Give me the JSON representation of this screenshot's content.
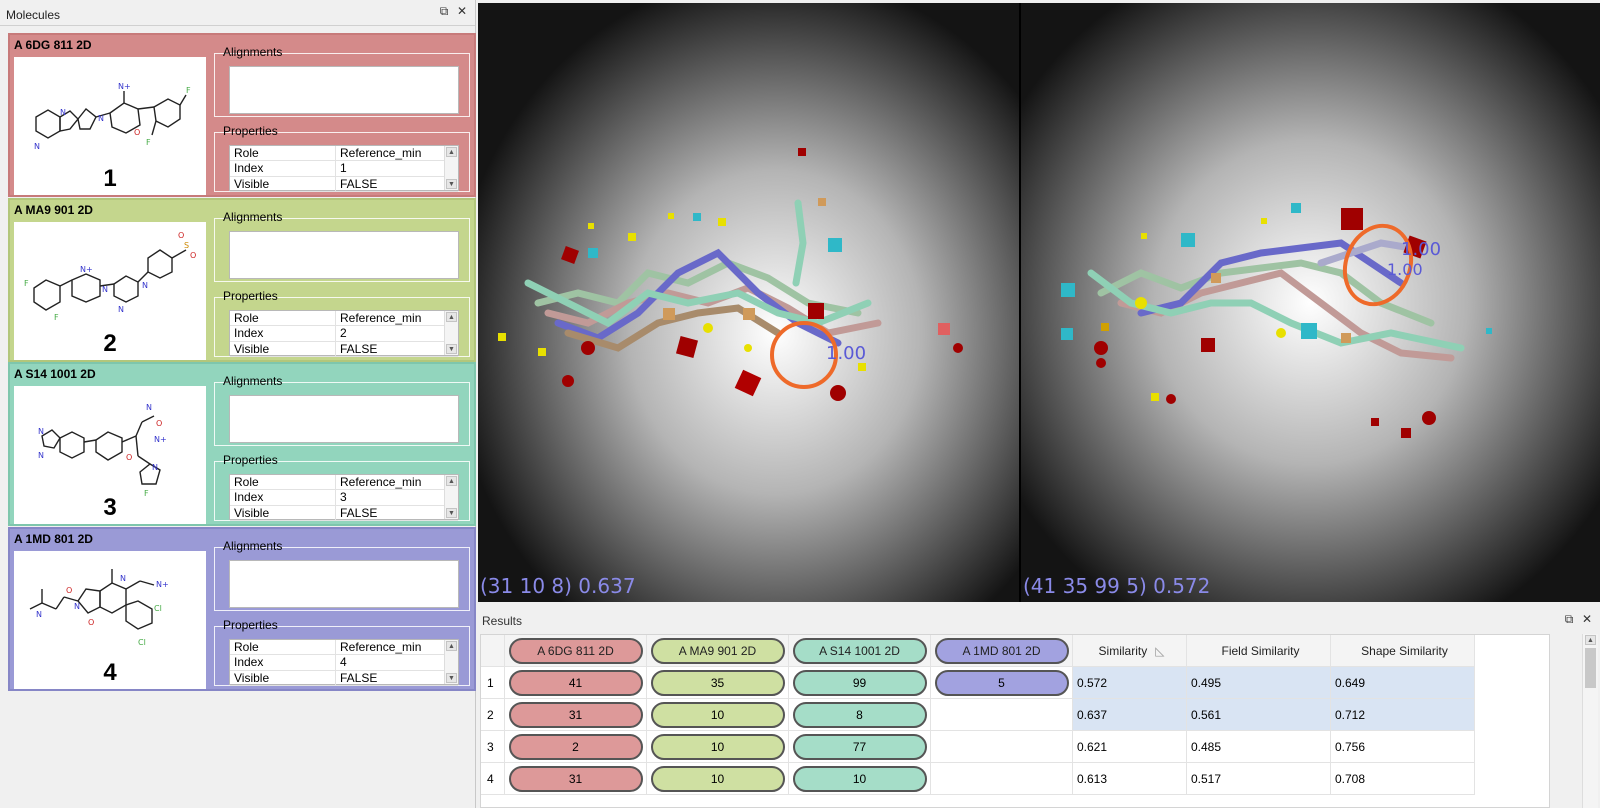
{
  "molecules_panel": {
    "title": "Molecules",
    "buttons": [
      "restore",
      "close"
    ],
    "cards": [
      {
        "title": "A 6DG 811 2D",
        "number": "1",
        "color": "#d48a8a",
        "alignments_label": "Alignments",
        "properties_label": "Properties",
        "properties": [
          [
            "Role",
            "Reference_min"
          ],
          [
            "Index",
            "1"
          ],
          [
            "Visible",
            "FALSE"
          ]
        ]
      },
      {
        "title": "A MA9 901 2D",
        "number": "2",
        "color": "#c4d68d",
        "alignments_label": "Alignments",
        "properties_label": "Properties",
        "properties": [
          [
            "Role",
            "Reference_min"
          ],
          [
            "Index",
            "2"
          ],
          [
            "Visible",
            "FALSE"
          ]
        ]
      },
      {
        "title": "A S14 1001 2D",
        "number": "3",
        "color": "#92d5bd",
        "alignments_label": "Alignments",
        "properties_label": "Properties",
        "properties": [
          [
            "Role",
            "Reference_min"
          ],
          [
            "Index",
            "3"
          ],
          [
            "Visible",
            "FALSE"
          ]
        ]
      },
      {
        "title": "A 1MD 801 2D",
        "number": "4",
        "color": "#9a9ad6",
        "alignments_label": "Alignments",
        "properties_label": "Properties",
        "properties": [
          [
            "Role",
            "Reference_min"
          ],
          [
            "Index",
            "4"
          ],
          [
            "Visible",
            "FALSE"
          ]
        ]
      }
    ]
  },
  "viewport": {
    "left_readout": "(31 10 8) 0.637",
    "right_readout": "(41 35 99 5) 0.572",
    "overlay_labels": [
      "1.00",
      "1.00",
      "1.00"
    ]
  },
  "results": {
    "title": "Results",
    "columns": [
      "A 6DG 811 2D",
      "A MA9 901 2D",
      "A S14 1001 2D",
      "A 1MD 801 2D",
      "Similarity",
      "Field Similarity",
      "Shape Similarity"
    ],
    "column_colors": [
      "#dd9999",
      "#cfe0a2",
      "#a5ddc8",
      "#a2a2e0"
    ],
    "rows": [
      {
        "n": "1",
        "m1": "41",
        "m2": "35",
        "m3": "99",
        "m4": "5",
        "sim": "0.572",
        "field": "0.495",
        "shape": "0.649",
        "selected": true
      },
      {
        "n": "2",
        "m1": "31",
        "m2": "10",
        "m3": "8",
        "m4": "",
        "sim": "0.637",
        "field": "0.561",
        "shape": "0.712",
        "selected": true
      },
      {
        "n": "3",
        "m1": "2",
        "m2": "10",
        "m3": "77",
        "m4": "",
        "sim": "0.621",
        "field": "0.485",
        "shape": "0.756",
        "selected": false
      },
      {
        "n": "4",
        "m1": "31",
        "m2": "10",
        "m3": "10",
        "m4": "",
        "sim": "0.613",
        "field": "0.517",
        "shape": "0.708",
        "selected": false
      }
    ]
  }
}
